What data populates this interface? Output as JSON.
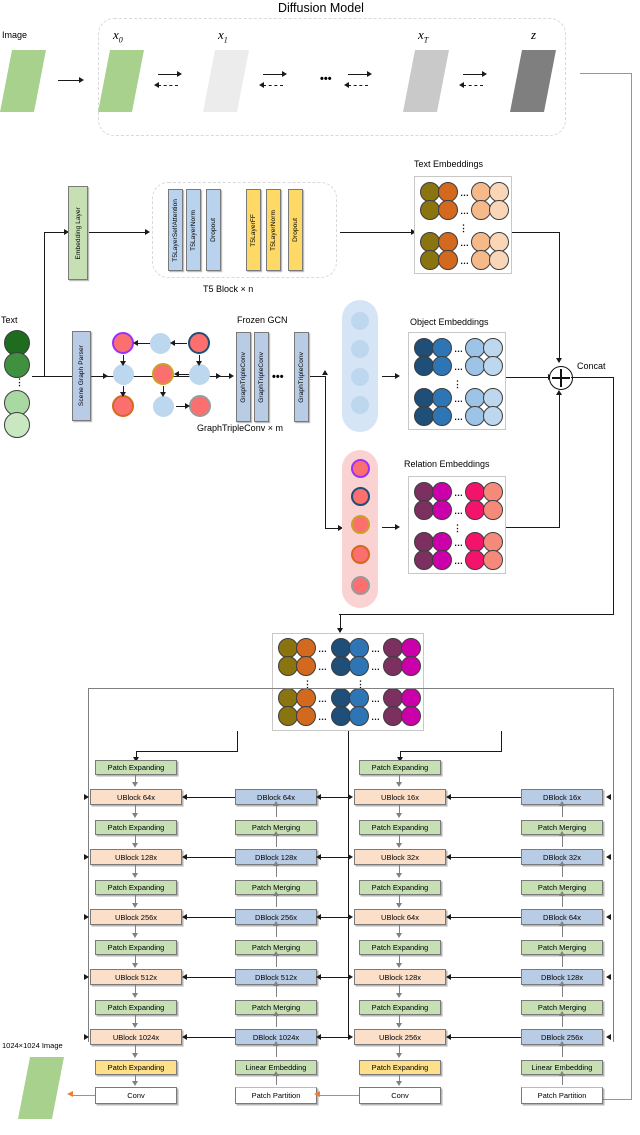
{
  "diagram": {
    "title": "Diffusion Model",
    "labels": {
      "image": "Image",
      "text": "Text",
      "concat": "Concat",
      "output_image": "1024×1024 Image"
    },
    "diffusion": {
      "steps": [
        "x0",
        "x1",
        "xT",
        "z"
      ],
      "step_display": [
        {
          "base": "x",
          "sub": "0"
        },
        {
          "base": "x",
          "sub": "1"
        },
        {
          "base": "x",
          "sub": "T"
        },
        {
          "base": "z",
          "sub": ""
        }
      ],
      "ellipsis": "•••"
    },
    "text_branch": {
      "embedding_layer": "Embedding Layer",
      "t5_block_caption": "T5 Block  × n",
      "t5_layers": [
        {
          "label": "T5LayerSelfAttention",
          "color": "#b9d3ee"
        },
        {
          "label": "T5LayerNorm",
          "color": "#b9d3ee"
        },
        {
          "label": "Dropout",
          "color": "#b9d3ee"
        },
        {
          "label": "T5LayerFF",
          "color": "#ffd966"
        },
        {
          "label": "T5LayerNorm",
          "color": "#ffd966"
        },
        {
          "label": "Dropout",
          "color": "#ffd966"
        }
      ],
      "text_embeddings_title": "Text Embeddings"
    },
    "graph_branch": {
      "scene_graph_parser": "Scene Graph Parser",
      "frozen_gcn": "Frozen GCN",
      "graph_conv_caption": "GraphTripleConv × m",
      "graph_conv_label": "GraphTripleConv",
      "graph_conv_ellipsis": "•••",
      "object_embeddings_title": "Object Embeddings",
      "relation_embeddings_title": "Relation Embeddings"
    },
    "colors": {
      "text_node": [
        "#1f6b1f",
        "#3f9140",
        "#a9d9a2",
        "#c9e8c2"
      ],
      "text_embeddings": [
        "#8a7410",
        "#d2691e",
        "#f6b98a",
        "#fad6b8"
      ],
      "object_embeddings": [
        "#1f4e79",
        "#2e75b6",
        "#9dc3e6",
        "#bdd7ee"
      ],
      "relation_embeddings": [
        "#7b3060",
        "#cc00aa",
        "#f4136b",
        "#f58a7a"
      ],
      "salmon": "#fb6f6f",
      "lightblue": "#bdd7ee",
      "accent_orange": "#ed7d31",
      "green_image": "#a9d18e"
    },
    "graph_nodes": [
      {
        "fill": "salmon",
        "stroke": "#9b30ff"
      },
      {
        "fill": "lightblue",
        "stroke": "#bdd7ee"
      },
      {
        "fill": "salmon",
        "stroke": "#1f4e79"
      },
      {
        "fill": "lightblue",
        "stroke": "#bdd7ee"
      },
      {
        "fill": "salmon",
        "stroke": "#c9a227"
      },
      {
        "fill": "lightblue",
        "stroke": "#bdd7ee"
      },
      {
        "fill": "salmon",
        "stroke": "#d2691e"
      },
      {
        "fill": "lightblue",
        "stroke": "#bdd7ee"
      },
      {
        "fill": "salmon",
        "stroke": "#9a9a9a"
      }
    ],
    "object_capsule_nodes": 4,
    "relation_capsule_nodes": [
      {
        "stroke": "#9b30ff"
      },
      {
        "stroke": "#1f4e79"
      },
      {
        "stroke": "#c9a227"
      },
      {
        "stroke": "#d2691e"
      },
      {
        "stroke": "#9a9a9a"
      }
    ],
    "unet": {
      "left": {
        "ublocks": [
          "UBlock 64x",
          "UBlock 128x",
          "UBlock 256x",
          "UBlock 512x",
          "UBlock 1024x"
        ],
        "dblocks": [
          "DBlock 64x",
          "DBlock 128x",
          "DBlock 256x",
          "DBlock 512x",
          "DBlock 1024x"
        ],
        "patch_expanding": "Patch Expanding",
        "patch_merging": "Patch Merging",
        "linear_embedding": "Linear Embedding",
        "patch_partition": "Patch Partition",
        "conv": "Conv"
      },
      "right": {
        "ublocks": [
          "UBlock 16x",
          "UBlock 32x",
          "UBlock 64x",
          "UBlock 128x",
          "UBlock 256x"
        ],
        "dblocks": [
          "DBlock 16x",
          "DBlock 32x",
          "DBlock 64x",
          "DBlock 128x",
          "DBlock 256x"
        ],
        "patch_expanding": "Patch Expanding",
        "patch_merging": "Patch Merging",
        "linear_embedding": "Linear Embedding",
        "patch_partition": "Patch Partition",
        "conv": "Conv"
      }
    }
  }
}
